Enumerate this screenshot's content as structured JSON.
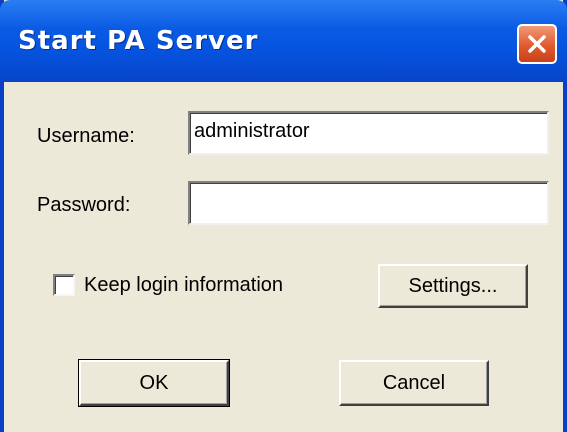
{
  "window": {
    "title": "Start PA Server"
  },
  "fields": {
    "username_label": "Username:",
    "username_value": "administrator",
    "password_label": "Password:",
    "password_value": ""
  },
  "options": {
    "keep_login_label": "Keep login information",
    "keep_login_checked": false
  },
  "buttons": {
    "settings": "Settings...",
    "ok": "OK",
    "cancel": "Cancel"
  },
  "icons": {
    "close": "close-icon"
  },
  "colors": {
    "titlebar": "#0554e0",
    "close": "#e05a2e",
    "background": "#ece9d8"
  }
}
